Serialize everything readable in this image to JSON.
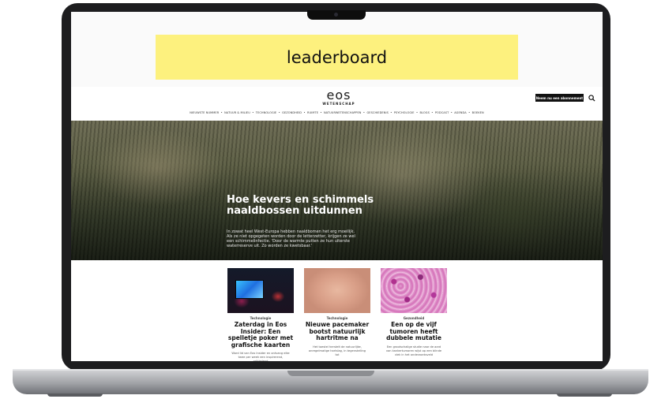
{
  "ad": {
    "label": "leaderboard"
  },
  "header": {
    "logo": "eos",
    "logo_sub": "WETENSCHAP",
    "subscribe_label": "Neem nu een abonnement",
    "search_icon": "search-icon"
  },
  "nav": {
    "items": [
      "NIEUWSTE NUMMER",
      "NATUUR & MILIEU",
      "TECHNOLOGIE",
      "GEZONDHEID",
      "RUIMTE",
      "NATUURWETENSCHAPPEN",
      "GESCHIEDENIS",
      "PSYCHOLOGIE",
      "BLOGS",
      "PODCAST",
      "AGENDA",
      "BOEKEN"
    ],
    "separator": "•"
  },
  "hero": {
    "title": "Hoe kevers en schimmels naaldbossen uitdunnen",
    "text": "In zowat heel West-Europa hebben naaldbomen het erg moeilijk. Als ze niet opgegeten worden door de letterzetter, krijgen ze wel een schimmelinfectie. 'Door de warmte putten ze hun uiterste waterreserve uit. Zo worden ze kwetsbaar.'"
  },
  "cards": [
    {
      "category": "Technologie",
      "title": "Zaterdag in Eos Insider: Een spelletje poker met grafische kaarten",
      "text": "Word lid van Eos Insider en ontvang elke twee per week een inspirerend, prikkelend"
    },
    {
      "category": "Technologie",
      "title": "Nieuwe pacemaker bootst natuurlijk hartritme na",
      "text": "Het toestel herstelt de natuurlijke, onregelmatige hartslag, in tegenstelling tot"
    },
    {
      "category": "Gezondheid",
      "title": "Een op de vijf tumoren heeft dubbele mutatie",
      "text": "Een grootschalige studie naar de aard van kankertumoren wijst op een blinde vlek in het onderzoeksveld"
    }
  ]
}
